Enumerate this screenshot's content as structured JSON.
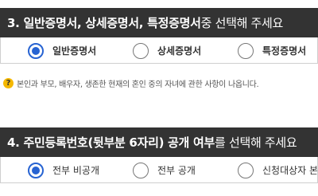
{
  "section3": {
    "title_bold": "3. 일반증명서, 상세증명서, 특정증명서",
    "title_rest": " 중 선택해 주세요",
    "options": [
      {
        "label": "일반증명서",
        "checked": true
      },
      {
        "label": "상세증명서",
        "checked": false
      },
      {
        "label": "특정증명서",
        "checked": false
      }
    ],
    "help_icon": "?",
    "help_text": "본인과 부모, 배우자, 생존한 현재의 혼인 중의 자녀에 관한 사항이 나옵니다."
  },
  "section4": {
    "title_bold": "4. 주민등록번호(뒷부분 6자리) 공개 여부",
    "title_rest": "를 선택해 주세요",
    "options": [
      {
        "label": "전부 비공개",
        "checked": true
      },
      {
        "label": "전부 공개",
        "checked": false
      },
      {
        "label": "신청대상자 본인",
        "checked": false
      }
    ]
  },
  "colors": {
    "header_bg": "#333333",
    "accent": "#2763d2",
    "help_icon": "#f5b800"
  }
}
